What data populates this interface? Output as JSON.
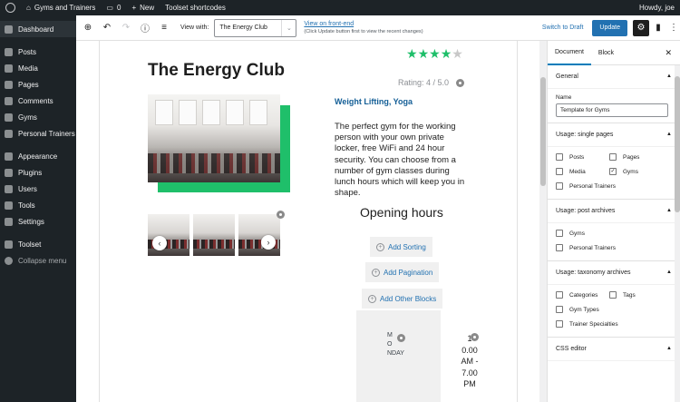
{
  "adminbar": {
    "site_name": "Gyms and Trainers",
    "comments_count": "0",
    "new_label": "New",
    "toolset_shortcodes": "Toolset shortcodes",
    "howdy": "Howdy, joe"
  },
  "sidebar": {
    "items": [
      {
        "label": "Dashboard",
        "icon": "dashboard-icon"
      },
      {
        "label": "Posts",
        "icon": "pin-icon"
      },
      {
        "label": "Media",
        "icon": "media-icon"
      },
      {
        "label": "Pages",
        "icon": "pages-icon"
      },
      {
        "label": "Comments",
        "icon": "comment-icon"
      },
      {
        "label": "Gyms",
        "icon": "gyms-icon"
      },
      {
        "label": "Personal Trainers",
        "icon": "trainers-icon"
      },
      {
        "label": "Appearance",
        "icon": "brush-icon"
      },
      {
        "label": "Plugins",
        "icon": "plugin-icon"
      },
      {
        "label": "Users",
        "icon": "users-icon"
      },
      {
        "label": "Tools",
        "icon": "wrench-icon"
      },
      {
        "label": "Settings",
        "icon": "settings-icon"
      },
      {
        "label": "Toolset",
        "icon": "toolset-icon"
      },
      {
        "label": "Collapse menu",
        "icon": "collapse-icon"
      }
    ]
  },
  "toolbar": {
    "view_with_label": "View with:",
    "view_with_value": "The Energy Club",
    "view_frontend": "View on front-end",
    "view_frontend_note": "(Click Update button first to view the recent changes)",
    "switch_to_draft": "Switch to Draft",
    "update": "Update"
  },
  "content": {
    "title": "The Energy Club",
    "stars_filled": 4,
    "stars_total": 5,
    "rating_text": "Rating: 4 / 5.0",
    "tags": "Weight Lifting, Yoga",
    "description": "The perfect gym for the working person with your own private locker, free WiFi and 24 hour security. You can choose from a number of gym classes during lunch hours which will keep you in shape.",
    "opening_hours": "Opening hours",
    "add_sorting": "Add Sorting",
    "add_pagination": "Add Pagination",
    "add_other_blocks": "Add Other Blocks",
    "day_lines": [
      "M",
      "O",
      "NDAY"
    ],
    "time_lines": [
      "1",
      "0.00",
      "AM -",
      "7.00",
      "PM"
    ]
  },
  "settings": {
    "tab_document": "Document",
    "tab_block": "Block",
    "general": "General",
    "name_label": "Name",
    "name_value": "Template for Gyms",
    "usage_single": "Usage: single pages",
    "single_options": [
      {
        "label": "Posts",
        "checked": false
      },
      {
        "label": "Pages",
        "checked": false
      },
      {
        "label": "Media",
        "checked": false
      },
      {
        "label": "Gyms",
        "checked": true
      },
      {
        "label": "Personal Trainers",
        "checked": false
      }
    ],
    "usage_post_archives": "Usage: post archives",
    "post_archive_options": [
      {
        "label": "Gyms",
        "checked": false
      },
      {
        "label": "Personal Trainers",
        "checked": false
      }
    ],
    "usage_taxonomy": "Usage: taxonomy archives",
    "taxonomy_options": [
      {
        "label": "Categories",
        "checked": false
      },
      {
        "label": "Tags",
        "checked": false
      },
      {
        "label": "Gym Types",
        "checked": false
      },
      {
        "label": "Trainer Specialties",
        "checked": false
      }
    ],
    "css_editor": "CSS editor"
  },
  "colors": {
    "accent": "#1fbf6a",
    "primary": "#2271b1",
    "admin_dark": "#1d2327"
  }
}
